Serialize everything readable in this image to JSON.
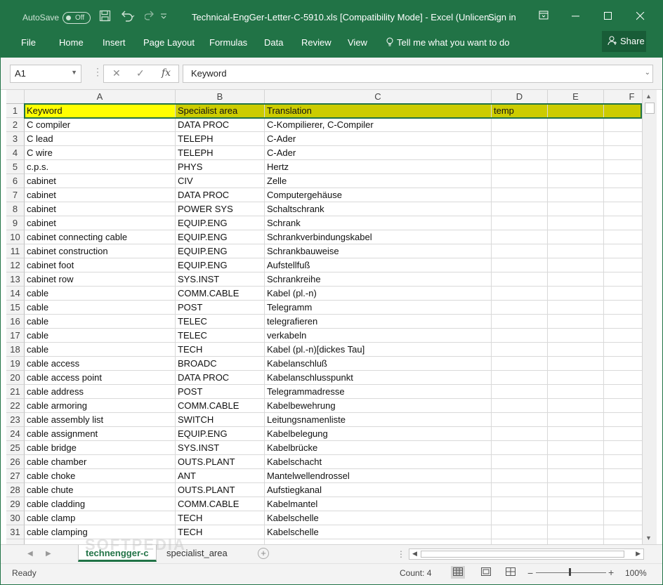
{
  "titlebar": {
    "autosave_label": "AutoSave",
    "autosave_state": "Off",
    "save_icon": "save-icon",
    "undo_icon": "undo-icon",
    "redo_icon": "redo-icon",
    "title": "Technical-EngGer-Letter-C-5910.xls  [Compatibility Mode]  -  Excel (Unlicen...",
    "signin": "Sign in",
    "ribbon_display_icon": "ribbon-display-icon",
    "minimize_icon": "minimize-icon",
    "maximize_icon": "maximize-icon",
    "close_icon": "close-icon"
  },
  "ribbon": {
    "tabs": [
      "File",
      "Home",
      "Insert",
      "Page Layout",
      "Formulas",
      "Data",
      "Review",
      "View"
    ],
    "tellme": "Tell me what you want to do",
    "share": "Share"
  },
  "formula_bar": {
    "name_box": "A1",
    "value": "Keyword"
  },
  "columns": [
    "A",
    "B",
    "C",
    "D",
    "E",
    "F"
  ],
  "rows": [
    {
      "n": "1",
      "a": "Keyword",
      "b": "Specialist area",
      "c": "Translation",
      "d": "temp"
    },
    {
      "n": "2",
      "a": "C compiler",
      "b": "DATA PROC",
      "c": "C-Kompilierer,  C-Compiler",
      "d": ""
    },
    {
      "n": "3",
      "a": "C lead",
      "b": "TELEPH",
      "c": "C-Ader",
      "d": ""
    },
    {
      "n": "4",
      "a": "C wire",
      "b": "TELEPH",
      "c": "C-Ader",
      "d": ""
    },
    {
      "n": "5",
      "a": "c.p.s.",
      "b": "PHYS",
      "c": "Hertz",
      "d": ""
    },
    {
      "n": "6",
      "a": "cabinet",
      "b": "CIV",
      "c": "Zelle",
      "d": ""
    },
    {
      "n": "7",
      "a": "cabinet",
      "b": "DATA PROC",
      "c": "Computergehäuse",
      "d": ""
    },
    {
      "n": "8",
      "a": "cabinet",
      "b": "POWER SYS",
      "c": "Schaltschrank",
      "d": ""
    },
    {
      "n": "9",
      "a": "cabinet",
      "b": "EQUIP.ENG",
      "c": "Schrank",
      "d": ""
    },
    {
      "n": "10",
      "a": "cabinet connecting cable",
      "b": "EQUIP.ENG",
      "c": "Schrankverbindungskabel",
      "d": ""
    },
    {
      "n": "11",
      "a": "cabinet construction",
      "b": "EQUIP.ENG",
      "c": "Schrankbauweise",
      "d": ""
    },
    {
      "n": "12",
      "a": "cabinet foot",
      "b": "EQUIP.ENG",
      "c": "Aufstellfuß",
      "d": ""
    },
    {
      "n": "13",
      "a": "cabinet row",
      "b": "SYS.INST",
      "c": "Schrankreihe",
      "d": ""
    },
    {
      "n": "14",
      "a": "cable",
      "b": "COMM.CABLE",
      "c": "Kabel (pl.-n)",
      "d": ""
    },
    {
      "n": "15",
      "a": "cable",
      "b": "POST",
      "c": "Telegramm",
      "d": ""
    },
    {
      "n": "16",
      "a": "cable",
      "b": "TELEC",
      "c": "telegrafieren",
      "d": ""
    },
    {
      "n": "17",
      "a": "cable",
      "b": "TELEC",
      "c": "verkabeln",
      "d": ""
    },
    {
      "n": "18",
      "a": "cable",
      "b": "TECH",
      "c": "Kabel (pl.-n)[dickes Tau]",
      "d": ""
    },
    {
      "n": "19",
      "a": "cable access",
      "b": "BROADC",
      "c": "Kabelanschluß",
      "d": ""
    },
    {
      "n": "20",
      "a": "cable access point",
      "b": "DATA PROC",
      "c": "Kabelanschlusspunkt",
      "d": ""
    },
    {
      "n": "21",
      "a": "cable address",
      "b": "POST",
      "c": "Telegrammadresse",
      "d": ""
    },
    {
      "n": "22",
      "a": "cable armoring",
      "b": "COMM.CABLE",
      "c": "Kabelbewehrung",
      "d": ""
    },
    {
      "n": "23",
      "a": "cable assembly list",
      "b": "SWITCH",
      "c": "Leitungsnamenliste",
      "d": ""
    },
    {
      "n": "24",
      "a": "cable assignment",
      "b": "EQUIP.ENG",
      "c": "Kabelbelegung",
      "d": ""
    },
    {
      "n": "25",
      "a": "cable bridge",
      "b": "SYS.INST",
      "c": "Kabelbrücke",
      "d": ""
    },
    {
      "n": "26",
      "a": "cable chamber",
      "b": "OUTS.PLANT",
      "c": "Kabelschacht",
      "d": ""
    },
    {
      "n": "27",
      "a": "cable choke",
      "b": "ANT",
      "c": "Mantelwellendrossel",
      "d": ""
    },
    {
      "n": "28",
      "a": "cable chute",
      "b": "OUTS.PLANT",
      "c": "Aufstiegkanal",
      "d": ""
    },
    {
      "n": "29",
      "a": "cable cladding",
      "b": "COMM.CABLE",
      "c": "Kabelmantel",
      "d": ""
    },
    {
      "n": "30",
      "a": "cable clamp",
      "b": "TECH",
      "c": "Kabelschelle",
      "d": ""
    },
    {
      "n": "31",
      "a": "cable clamping",
      "b": "TECH",
      "c": "Kabelschelle",
      "d": ""
    }
  ],
  "sheets": {
    "active": "technengger-c",
    "other": "specialist_area"
  },
  "status": {
    "ready": "Ready",
    "count": "Count: 4",
    "zoom": "100%"
  },
  "watermark": "SOFTPEDIA"
}
